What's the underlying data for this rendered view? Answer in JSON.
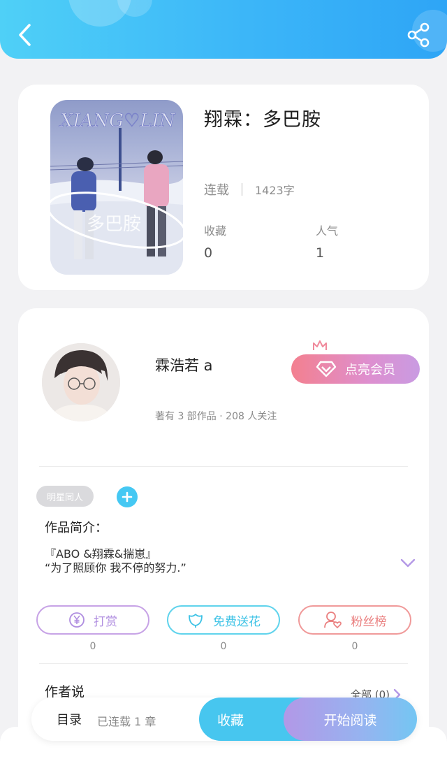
{
  "colors": {
    "header_start": "#4fd0f7",
    "header_end": "#2ea5f6",
    "accent_blue": "#47c6ef",
    "member_pink": "#f3808f",
    "member_purple": "#c99be2"
  },
  "header": {
    "back_icon": "chevron-left-icon",
    "share_icon": "share-icon"
  },
  "book": {
    "cover_text": "XIANG♡LIN",
    "cover_script": "多巴胺",
    "title": "翔霖：多巴胺",
    "status": "连载",
    "word_count": "1423字",
    "favorites_label": "收藏",
    "favorites_value": "0",
    "popularity_label": "人气",
    "popularity_value": "1"
  },
  "author": {
    "name": "霖浩若 a",
    "meta": "著有 3 部作品 · 208 人关注",
    "member_button": "点亮会员",
    "tag": "明星同人",
    "intro_heading": "作品简介：",
    "intro_lines": [
      "『ABO &翔霖&揣崽』",
      "“为了照顾你 我不停的努力.”"
    ],
    "actions": [
      {
        "label": "打赏",
        "count": "0",
        "icon": "yen-coin-icon"
      },
      {
        "label": "免费送花",
        "count": "0",
        "icon": "flower-icon"
      },
      {
        "label": "粉丝榜",
        "count": "0",
        "icon": "user-heart-icon"
      }
    ],
    "author_says": "作者说",
    "all_link": "全部 (0)"
  },
  "bottom_bar": {
    "toc": "目录",
    "chapters": "已连载 1 章",
    "favorite": "收藏",
    "start_reading": "开始阅读"
  }
}
